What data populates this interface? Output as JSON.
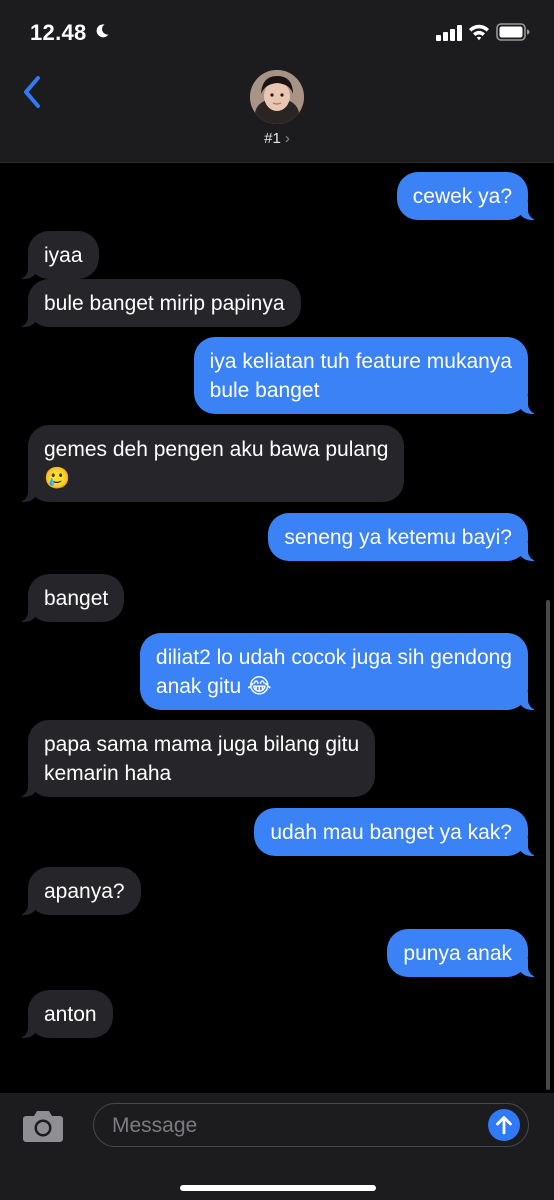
{
  "status_bar": {
    "time": "12.48",
    "icons": [
      "moon-icon",
      "cellular-signal-icon",
      "wifi-icon",
      "battery-icon"
    ]
  },
  "header": {
    "contact_name": "#1",
    "chevron": "›",
    "back_icon": "chevron-left-icon"
  },
  "messages": [
    {
      "from": "me",
      "lines": [
        "cewek ya?"
      ]
    },
    {
      "from": "them",
      "lines": [
        "iyaa"
      ]
    },
    {
      "from": "them",
      "lines": [
        "bule banget mirip papinya"
      ]
    },
    {
      "from": "me",
      "lines": [
        "iya keliatan tuh feature mukanya",
        "bule banget"
      ]
    },
    {
      "from": "them",
      "lines": [
        "gemes deh pengen aku bawa pulang",
        "🥲"
      ]
    },
    {
      "from": "me",
      "lines": [
        "seneng ya ketemu bayi?"
      ]
    },
    {
      "from": "them",
      "lines": [
        "banget"
      ]
    },
    {
      "from": "me",
      "lines": [
        "diliat2 lo udah cocok juga sih gendong",
        "anak gitu 😂"
      ]
    },
    {
      "from": "them",
      "lines": [
        "papa sama mama juga bilang gitu",
        "kemarin haha"
      ]
    },
    {
      "from": "me",
      "lines": [
        "udah mau banget ya kak?"
      ]
    },
    {
      "from": "them",
      "lines": [
        "apanya?"
      ]
    },
    {
      "from": "me",
      "lines": [
        "punya anak"
      ]
    },
    {
      "from": "them",
      "lines": [
        "anton"
      ]
    }
  ],
  "input_bar": {
    "placeholder": "Message",
    "camera_icon": "camera-icon",
    "send_icon": "arrow-up-icon"
  },
  "colors": {
    "outgoing": "#3a82f6",
    "incoming": "#26262a",
    "background": "#000000",
    "bar": "#1c1c1e"
  }
}
